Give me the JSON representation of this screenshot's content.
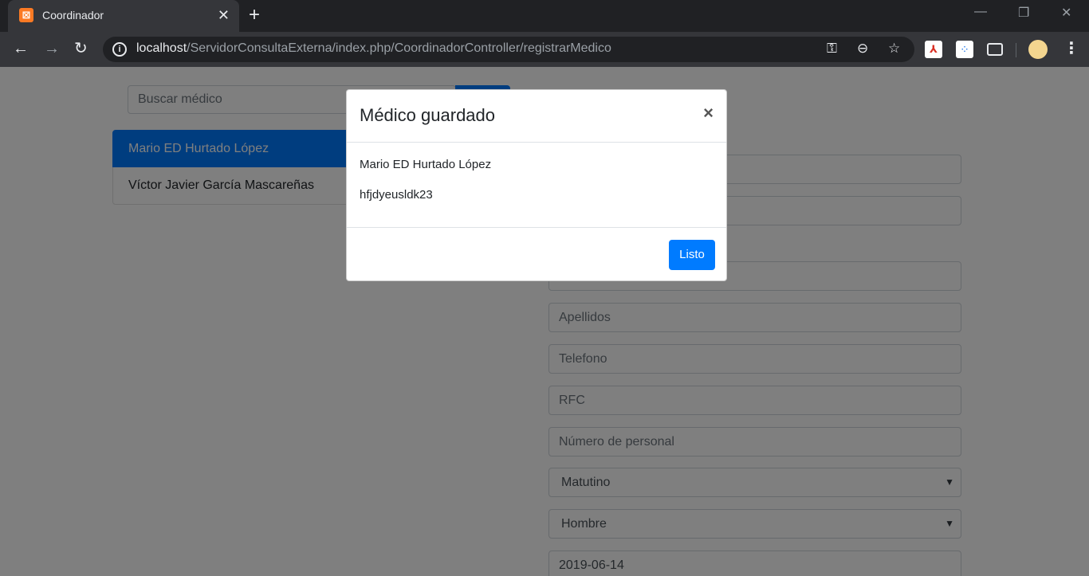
{
  "browser": {
    "tab_title": "Coordinador",
    "favicon_glyph": "ꟷ",
    "url_host": "localhost",
    "url_path": "/ServidorConsultaExterna/index.php/CoordinadorController/registrarMedico"
  },
  "search": {
    "placeholder": "Buscar médico"
  },
  "doctor_list": [
    {
      "name": "Mario ED Hurtado López",
      "active": true
    },
    {
      "name": "Víctor Javier García Mascareñas",
      "active": false
    }
  ],
  "form": {
    "apellidos_placeholder": "Apellidos",
    "telefono_placeholder": "Telefono",
    "rfc_placeholder": "RFC",
    "numero_personal_placeholder": "Número de personal",
    "turno_value": "Matutino",
    "sexo_value": "Hombre",
    "fecha_value": "2019-06-14"
  },
  "modal": {
    "title": "Médico guardado",
    "line1": "Mario ED Hurtado López",
    "line2": "hfjdyeusldk23",
    "ok_label": "Listo"
  },
  "colors": {
    "primary": "#007bff",
    "chrome_dark": "#202124",
    "chrome_toolbar": "#35363a"
  }
}
